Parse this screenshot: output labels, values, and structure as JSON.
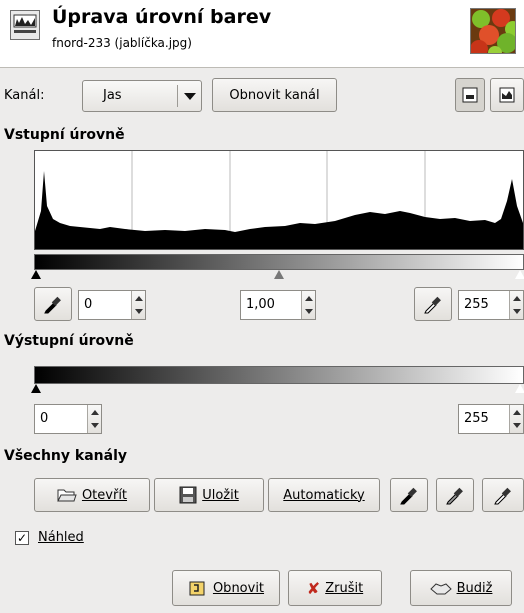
{
  "header": {
    "title": "Úprava úrovní barev",
    "subtitle": "fnord-233 (jablíčka.jpg)"
  },
  "channel": {
    "label": "Kanál:",
    "value": "Jas",
    "reset_label": "Obnovit kanál"
  },
  "input_levels": {
    "heading": "Vstupní úrovně",
    "low": "0",
    "gamma": "1,00",
    "high": "255"
  },
  "output_levels": {
    "heading": "Výstupní úrovně",
    "low": "0",
    "high": "255"
  },
  "all_channels": {
    "heading": "Všechny kanály",
    "open_label": "Otevřít",
    "save_label": "Uložit",
    "auto_label": "Automaticky"
  },
  "preview": {
    "label": "Náhled",
    "checked": true
  },
  "footer": {
    "reset_label": "Obnovit",
    "cancel_label": "Zrušit",
    "ok_label": "Budiž"
  }
}
